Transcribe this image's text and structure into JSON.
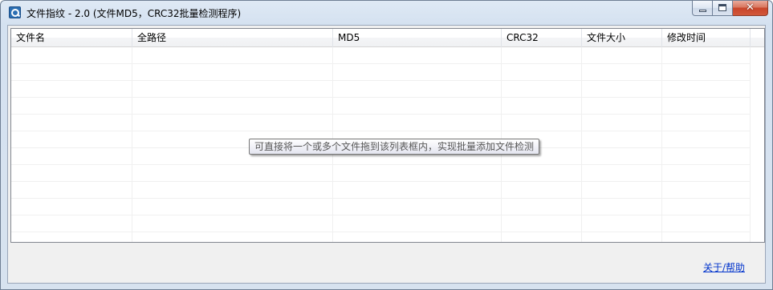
{
  "window": {
    "title": "文件指纹 - 2.0 (文件MD5，CRC32批量检测程序)"
  },
  "list": {
    "columns": [
      "文件名",
      "全路径",
      "MD5",
      "CRC32",
      "文件大小",
      "修改时间"
    ],
    "rows": []
  },
  "tooltip": {
    "text": "可直接将一个或多个文件拖到该列表框内，实现批量添加文件检测"
  },
  "footer": {
    "about_link": "关于/帮助"
  },
  "icons": {
    "app": "magnifier-icon",
    "minimize": "minimize-icon",
    "maximize": "maximize-icon",
    "close": "close-icon"
  }
}
